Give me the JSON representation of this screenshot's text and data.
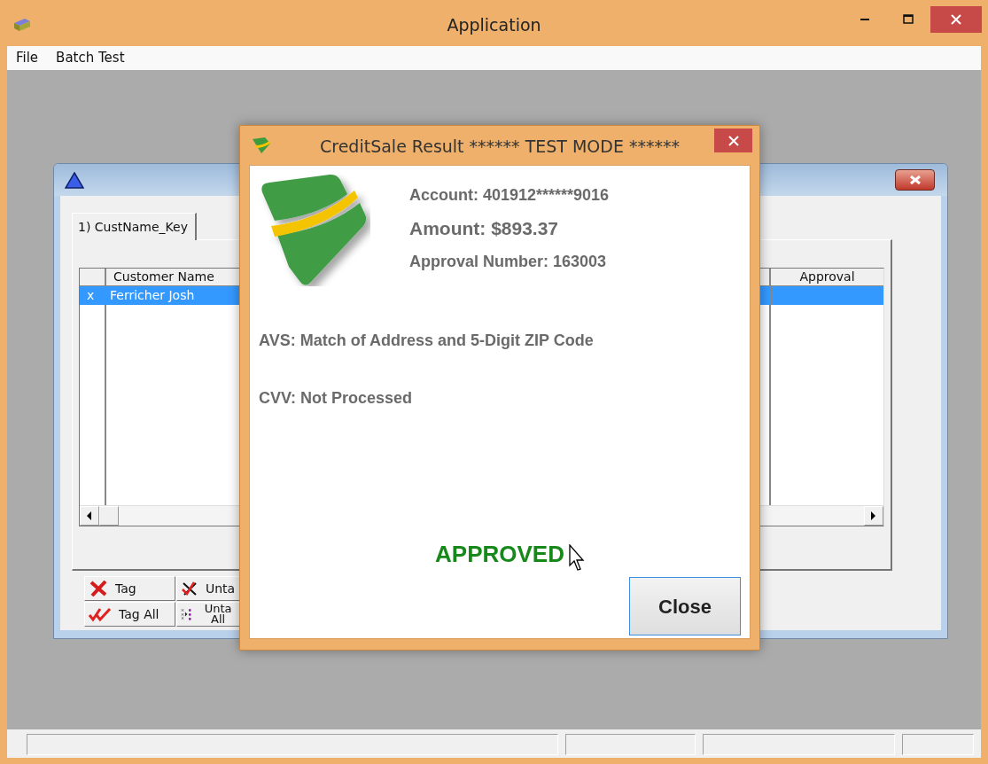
{
  "window": {
    "title": "Application"
  },
  "menu": [
    {
      "label": "File"
    },
    {
      "label": "Batch Test"
    }
  ],
  "child_window": {
    "tabs": [
      {
        "label": "1) CustName_Key",
        "selected": true
      }
    ],
    "grid": {
      "columns": [
        "Customer Name",
        "Approval"
      ],
      "rows": [
        {
          "marker": "x",
          "customer_name": "Ferricher Josh",
          "selected": true
        }
      ]
    },
    "buttons": [
      {
        "label": "Tag",
        "kind": "tag"
      },
      {
        "label": "Unta",
        "kind": "untag"
      },
      {
        "label": "Tag All",
        "kind": "tag-all"
      },
      {
        "label": "Unta All",
        "kind": "untag-all"
      }
    ]
  },
  "dialog": {
    "title": "CreditSale Result ****** TEST MODE ******",
    "account": "Account: 401912******9016",
    "amount": "Amount: $893.37",
    "approval_number": "Approval Number: 163003",
    "avs": "AVS: Match of Address and 5-Digit ZIP Code",
    "cvv": "CVV: Not Processed",
    "result": "APPROVED",
    "close_button": "Close"
  }
}
